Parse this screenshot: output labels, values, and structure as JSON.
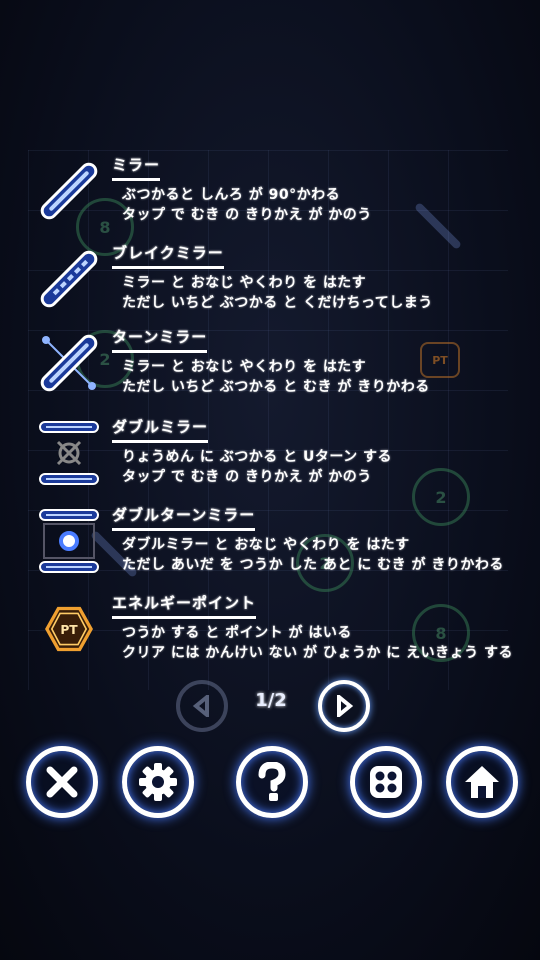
{
  "entries": [
    {
      "title": "ミラー",
      "line1": "ぶつかると しんろ が 90°かわる",
      "line2": "タップ で むき の きりかえ が かのう",
      "icon": "mirror-icon"
    },
    {
      "title": "ブレイクミラー",
      "line1": "ミラー と おなじ やくわり を はたす",
      "line2": "ただし いちど ぶつかる と くだけちってしまう",
      "icon": "break-mirror-icon"
    },
    {
      "title": "ターンミラー",
      "line1": "ミラー と おなじ やくわり を はたす",
      "line2": "ただし いちど ぶつかる と むき が きりかわる",
      "icon": "turn-mirror-icon"
    },
    {
      "title": "ダブルミラー",
      "line1": "りょうめん に ぶつかる と Uターン する",
      "line2": "タップ で むき の きりかえ が かのう",
      "icon": "double-mirror-icon"
    },
    {
      "title": "ダブルターンミラー",
      "line1": "ダブルミラー と おなじ やくわり を はたす",
      "line2": "ただし あいだ を つうか した あと に むき が きりかわる",
      "icon": "double-turn-mirror-icon"
    },
    {
      "title": "エネルギーポイント",
      "line1": "つうか する と ポイント が はいる",
      "line2": "クリア には かんけい ない が ひょうか に えいきょう する",
      "icon": "energy-point-icon",
      "badge": "PT"
    }
  ],
  "pager": {
    "page": "1/2",
    "prev_icon": "chevron-left-icon",
    "next_icon": "chevron-right-icon"
  },
  "toolbar": [
    {
      "icon": "close-icon"
    },
    {
      "icon": "gear-icon"
    },
    {
      "icon": "help-icon"
    },
    {
      "icon": "stage-select-icon"
    },
    {
      "icon": "home-icon"
    }
  ],
  "background": {
    "pt_label": "PT",
    "hex_labels": [
      "8",
      "2",
      "2",
      "2",
      "8"
    ]
  },
  "colors": {
    "accent": "#4a7cff",
    "mirror": "#8fb4ff",
    "energy": "#f0a030"
  }
}
